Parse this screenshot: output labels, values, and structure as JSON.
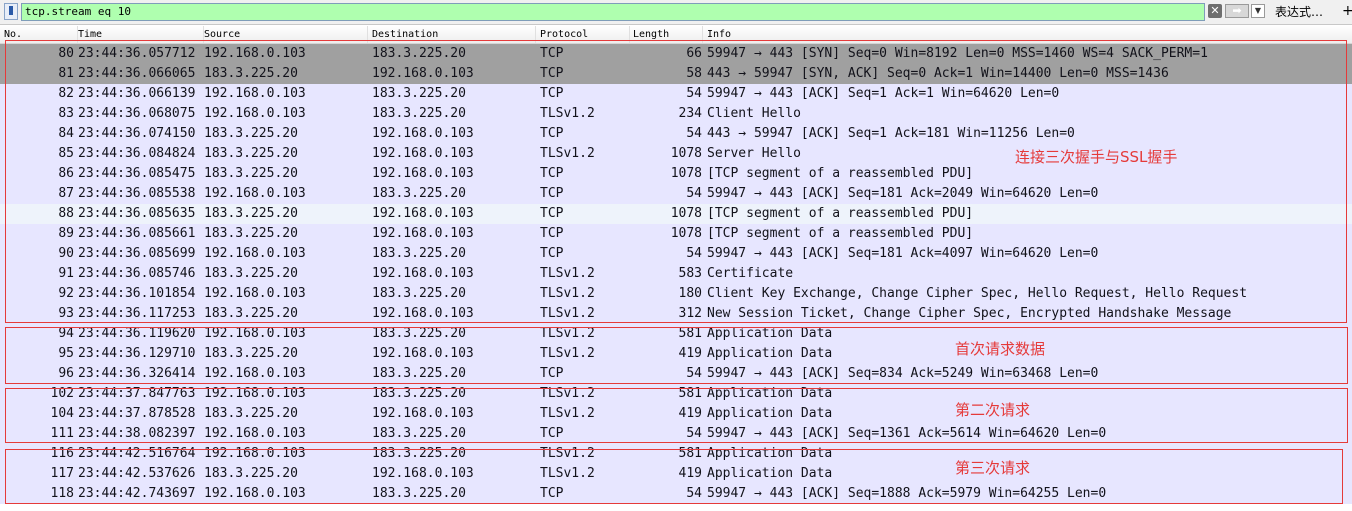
{
  "filter": {
    "value": "tcp.stream eq 10",
    "clear_glyph": "✕",
    "apply_glyph": "➡",
    "dropdown_glyph": "▼",
    "expression_label": "表达式…",
    "add_glyph": "+"
  },
  "columns": {
    "no": "No.",
    "time": "Time",
    "source": "Source",
    "destination": "Destination",
    "protocol": "Protocol",
    "length": "Length",
    "info": "Info"
  },
  "colors": {
    "row_default": "#e7e6ff",
    "row_gray": "#a0a0a0",
    "row_selected": "#eef3fb",
    "annotation": "#e53a3a",
    "filter_valid": "#afffaf"
  },
  "packets": [
    {
      "no": "80",
      "time": "23:44:36.057712",
      "source": "192.168.0.103",
      "destination": "183.3.225.20",
      "protocol": "TCP",
      "length": "66",
      "info": "59947 → 443 [SYN] Seq=0 Win=8192 Len=0 MSS=1460 WS=4 SACK_PERM=1",
      "style": "gray"
    },
    {
      "no": "81",
      "time": "23:44:36.066065",
      "source": "183.3.225.20",
      "destination": "192.168.0.103",
      "protocol": "TCP",
      "length": "58",
      "info": "443 → 59947 [SYN, ACK] Seq=0 Ack=1 Win=14400 Len=0 MSS=1436",
      "style": "gray"
    },
    {
      "no": "82",
      "time": "23:44:36.066139",
      "source": "192.168.0.103",
      "destination": "183.3.225.20",
      "protocol": "TCP",
      "length": "54",
      "info": "59947 → 443 [ACK] Seq=1 Ack=1 Win=64620 Len=0",
      "style": "default"
    },
    {
      "no": "83",
      "time": "23:44:36.068075",
      "source": "192.168.0.103",
      "destination": "183.3.225.20",
      "protocol": "TLSv1.2",
      "length": "234",
      "info": "Client Hello",
      "style": "default"
    },
    {
      "no": "84",
      "time": "23:44:36.074150",
      "source": "183.3.225.20",
      "destination": "192.168.0.103",
      "protocol": "TCP",
      "length": "54",
      "info": "443 → 59947 [ACK] Seq=1 Ack=181 Win=11256 Len=0",
      "style": "default"
    },
    {
      "no": "85",
      "time": "23:44:36.084824",
      "source": "183.3.225.20",
      "destination": "192.168.0.103",
      "protocol": "TLSv1.2",
      "length": "1078",
      "info": "Server Hello",
      "style": "default"
    },
    {
      "no": "86",
      "time": "23:44:36.085475",
      "source": "183.3.225.20",
      "destination": "192.168.0.103",
      "protocol": "TCP",
      "length": "1078",
      "info": "[TCP segment of a reassembled PDU]",
      "style": "default"
    },
    {
      "no": "87",
      "time": "23:44:36.085538",
      "source": "192.168.0.103",
      "destination": "183.3.225.20",
      "protocol": "TCP",
      "length": "54",
      "info": "59947 → 443 [ACK] Seq=181 Ack=2049 Win=64620 Len=0",
      "style": "default"
    },
    {
      "no": "88",
      "time": "23:44:36.085635",
      "source": "183.3.225.20",
      "destination": "192.168.0.103",
      "protocol": "TCP",
      "length": "1078",
      "info": "[TCP segment of a reassembled PDU]",
      "style": "selected"
    },
    {
      "no": "89",
      "time": "23:44:36.085661",
      "source": "183.3.225.20",
      "destination": "192.168.0.103",
      "protocol": "TCP",
      "length": "1078",
      "info": "[TCP segment of a reassembled PDU]",
      "style": "default"
    },
    {
      "no": "90",
      "time": "23:44:36.085699",
      "source": "192.168.0.103",
      "destination": "183.3.225.20",
      "protocol": "TCP",
      "length": "54",
      "info": "59947 → 443 [ACK] Seq=181 Ack=4097 Win=64620 Len=0",
      "style": "default"
    },
    {
      "no": "91",
      "time": "23:44:36.085746",
      "source": "183.3.225.20",
      "destination": "192.168.0.103",
      "protocol": "TLSv1.2",
      "length": "583",
      "info": "Certificate",
      "style": "default"
    },
    {
      "no": "92",
      "time": "23:44:36.101854",
      "source": "192.168.0.103",
      "destination": "183.3.225.20",
      "protocol": "TLSv1.2",
      "length": "180",
      "info": "Client Key Exchange, Change Cipher Spec, Hello Request, Hello Request",
      "style": "default"
    },
    {
      "no": "93",
      "time": "23:44:36.117253",
      "source": "183.3.225.20",
      "destination": "192.168.0.103",
      "protocol": "TLSv1.2",
      "length": "312",
      "info": "New Session Ticket, Change Cipher Spec, Encrypted Handshake Message",
      "style": "default"
    },
    {
      "no": "94",
      "time": "23:44:36.119620",
      "source": "192.168.0.103",
      "destination": "183.3.225.20",
      "protocol": "TLSv1.2",
      "length": "581",
      "info": "Application Data",
      "style": "default"
    },
    {
      "no": "95",
      "time": "23:44:36.129710",
      "source": "183.3.225.20",
      "destination": "192.168.0.103",
      "protocol": "TLSv1.2",
      "length": "419",
      "info": "Application Data",
      "style": "default"
    },
    {
      "no": "96",
      "time": "23:44:36.326414",
      "source": "192.168.0.103",
      "destination": "183.3.225.20",
      "protocol": "TCP",
      "length": "54",
      "info": "59947 → 443 [ACK] Seq=834 Ack=5249 Win=63468 Len=0",
      "style": "default"
    },
    {
      "no": "102",
      "time": "23:44:37.847763",
      "source": "192.168.0.103",
      "destination": "183.3.225.20",
      "protocol": "TLSv1.2",
      "length": "581",
      "info": "Application Data",
      "style": "default"
    },
    {
      "no": "104",
      "time": "23:44:37.878528",
      "source": "183.3.225.20",
      "destination": "192.168.0.103",
      "protocol": "TLSv1.2",
      "length": "419",
      "info": "Application Data",
      "style": "default"
    },
    {
      "no": "111",
      "time": "23:44:38.082397",
      "source": "192.168.0.103",
      "destination": "183.3.225.20",
      "protocol": "TCP",
      "length": "54",
      "info": "59947 → 443 [ACK] Seq=1361 Ack=5614 Win=64620 Len=0",
      "style": "default"
    },
    {
      "no": "116",
      "time": "23:44:42.516764",
      "source": "192.168.0.103",
      "destination": "183.3.225.20",
      "protocol": "TLSv1.2",
      "length": "581",
      "info": "Application Data",
      "style": "default"
    },
    {
      "no": "117",
      "time": "23:44:42.537626",
      "source": "183.3.225.20",
      "destination": "192.168.0.103",
      "protocol": "TLSv1.2",
      "length": "419",
      "info": "Application Data",
      "style": "default"
    },
    {
      "no": "118",
      "time": "23:44:42.743697",
      "source": "192.168.0.103",
      "destination": "183.3.225.20",
      "protocol": "TCP",
      "length": "54",
      "info": "59947 → 443 [ACK] Seq=1888 Ack=5979 Win=64255 Len=0",
      "style": "default"
    }
  ],
  "annotations": [
    {
      "label": "连接三次握手与SSL握手"
    },
    {
      "label": "首次请求数据"
    },
    {
      "label": "第二次请求"
    },
    {
      "label": "第三次请求"
    }
  ]
}
